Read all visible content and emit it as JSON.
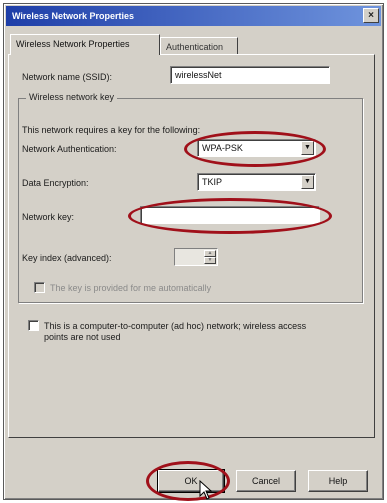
{
  "window": {
    "title": "Wireless Network Properties",
    "close_glyph": "×"
  },
  "tabs": [
    {
      "label": "Wireless Network Properties"
    },
    {
      "label": "Authentication"
    }
  ],
  "form": {
    "ssid_label": "Network name (SSID):",
    "ssid_value": "wirelessNet",
    "group_title": "Wireless network key",
    "key_note": "This network requires a key for the following:",
    "auth_label": "Network Authentication:",
    "auth_value": "WPA-PSK",
    "encryption_label": "Data Encryption:",
    "encryption_value": "TKIP",
    "key_label": "Network key:",
    "key_value": "",
    "key_index_label": "Key index (advanced):",
    "key_index_value": "",
    "auto_key_label": "The key is provided for me automatically",
    "adhoc_label_line1": "This is a computer-to-computer (ad hoc) network; wireless access",
    "adhoc_label_line2": "points are not used"
  },
  "buttons": {
    "ok": "OK",
    "cancel": "Cancel",
    "help": "Help"
  },
  "annotation_color": "#a0101a"
}
